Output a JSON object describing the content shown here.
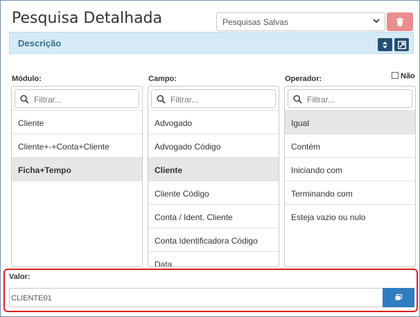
{
  "page": {
    "title": "Pesquisa Detalhada"
  },
  "saved_searches": {
    "selected": "Pesquisas Salvas"
  },
  "description_bar": {
    "label": "Descrição"
  },
  "columns": {
    "modulo": {
      "label": "Módulo:",
      "filter_placeholder": "Filtrar...",
      "items": [
        "Cliente",
        "Cliente+-+Conta+Cliente",
        "Ficha+Tempo"
      ],
      "selected_index": 2
    },
    "campo": {
      "label": "Campo:",
      "filter_placeholder": "Filtrar...",
      "items": [
        "Advogado",
        "Advogado Código",
        "Cliente",
        "Cliente Código",
        "Conta / Ident. Cliente",
        "Conta Identificadora Código",
        "Data"
      ],
      "selected_index": 2
    },
    "operador": {
      "label": "Operador:",
      "filter_placeholder": "Filtrar...",
      "items": [
        "Igual",
        "Contém",
        "Iniciando com",
        "Terminando com",
        "Esteja vazio ou nulo"
      ],
      "selected_index": 0,
      "nao_label": "Não",
      "nao_checked": false
    }
  },
  "valor": {
    "label": "Valor:",
    "value": "CLIENTE01"
  },
  "colors": {
    "accent": "#2f7dc0",
    "danger": "#e88e8e",
    "highlight": "#e02020",
    "desc_bg": "#d5eaf6"
  }
}
